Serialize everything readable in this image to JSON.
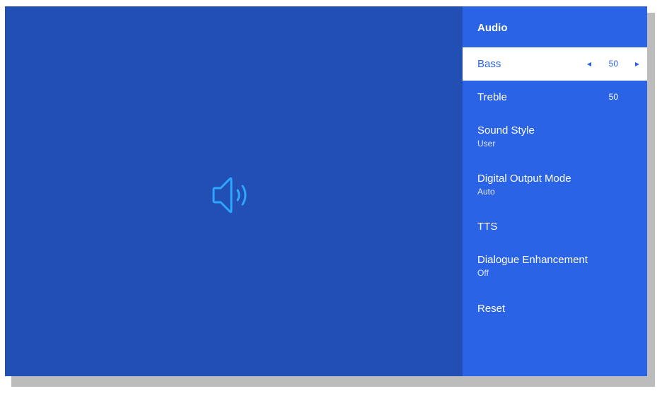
{
  "panel": {
    "title": "Audio",
    "items": [
      {
        "label": "Bass",
        "value": "50"
      },
      {
        "label": "Treble",
        "value": "50"
      },
      {
        "label": "Sound Style",
        "sub": "User"
      },
      {
        "label": "Digital Output Mode",
        "sub": "Auto"
      },
      {
        "label": "TTS"
      },
      {
        "label": "Dialogue Enhancement",
        "sub": "Off"
      },
      {
        "label": "Reset"
      }
    ],
    "selected_index": 0
  },
  "preview": {
    "icon": "speaker-volume-icon"
  },
  "colors": {
    "preview_bg": "#224fb4",
    "panel_bg": "#2a63e5",
    "selected_bg": "#ffffff",
    "icon_stroke": "#2ea6ff"
  }
}
